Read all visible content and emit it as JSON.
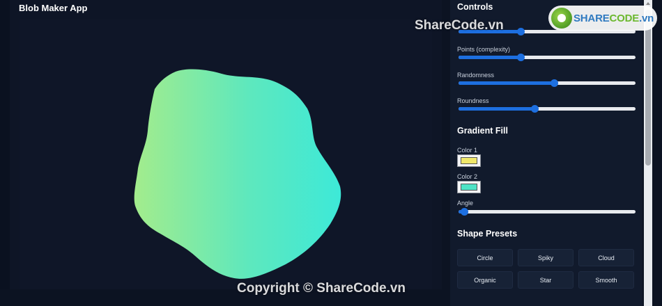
{
  "app": {
    "title": "Blob Maker App"
  },
  "watermark": {
    "top": "ShareCode.vn",
    "bottom": "Copyright © ShareCode.vn",
    "logo_part1": "SHARE",
    "logo_part2": "CODE",
    "logo_part3": ".vn"
  },
  "blob": {
    "gradient_start": "#a3ec8c",
    "gradient_mid": "#5ee8bd",
    "gradient_end": "#3de9d8"
  },
  "controls": {
    "title": "Controls",
    "sliders": [
      {
        "label": "",
        "value": 0.35
      },
      {
        "label": "Points (complexity)",
        "value": 0.35
      },
      {
        "label": "Randomness",
        "value": 0.54
      },
      {
        "label": "Roundness",
        "value": 0.43
      }
    ]
  },
  "gradient_fill": {
    "title": "Gradient Fill",
    "color1_label": "Color 1",
    "color1": "#f0e86a",
    "color2_label": "Color 2",
    "color2": "#4ee3c6",
    "angle_label": "Angle",
    "angle_value": 0.03
  },
  "shape_presets": {
    "title": "Shape Presets",
    "buttons": [
      "Circle",
      "Spiky",
      "Cloud",
      "Organic",
      "Star",
      "Smooth"
    ]
  },
  "colors": {
    "accent": "#1d6fe0"
  }
}
